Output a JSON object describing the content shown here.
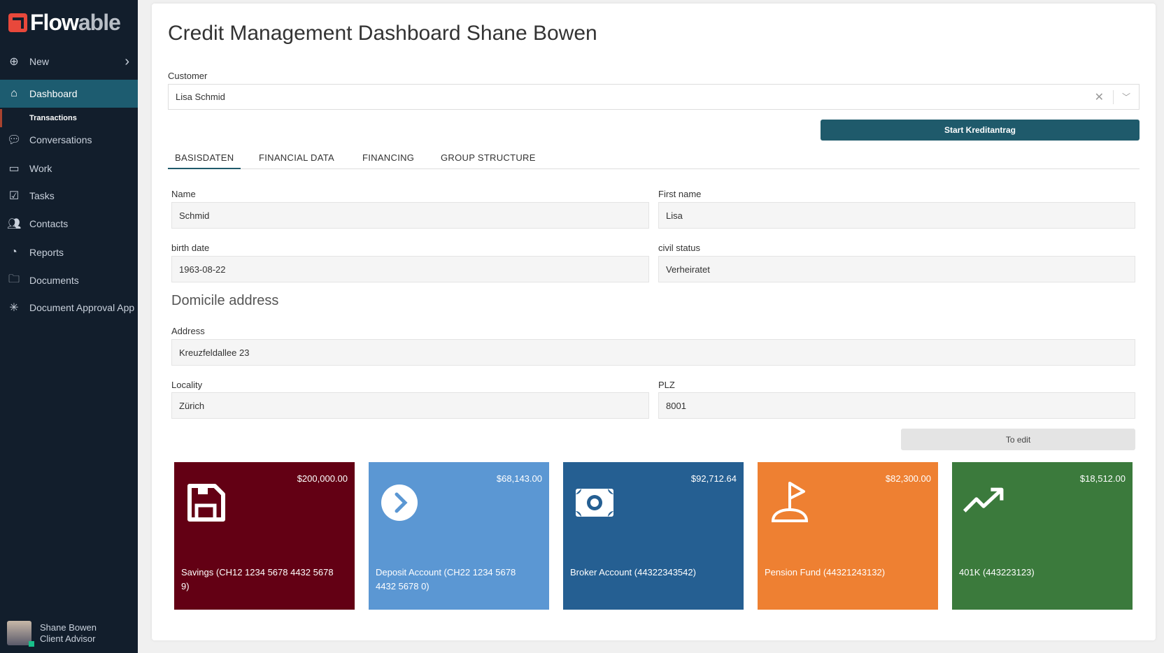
{
  "sidebar": {
    "logo": "Flowable",
    "items": [
      {
        "label": "New",
        "icon": "plus-circle-icon"
      },
      {
        "label": "Dashboard",
        "icon": "home-icon",
        "active": true
      },
      {
        "label": "Conversations",
        "icon": "chat-icon"
      },
      {
        "label": "Work",
        "icon": "inbox-icon"
      },
      {
        "label": "Tasks",
        "icon": "clipboard-check-icon"
      },
      {
        "label": "Contacts",
        "icon": "users-icon"
      },
      {
        "label": "Reports",
        "icon": "pie-chart-icon"
      },
      {
        "label": "Documents",
        "icon": "folder-icon"
      },
      {
        "label": "Document Approval App",
        "icon": "asterisk-icon"
      }
    ],
    "sub_item": "Transactions",
    "user": {
      "name": "Shane Bowen",
      "role": "Client Advisor",
      "status_color": "#18c08a"
    }
  },
  "main": {
    "title": "Credit Management Dashboard Shane Bowen",
    "customer_label": "Customer",
    "customer_value": "Lisa Schmid",
    "start_button": "Start Kreditantrag",
    "tabs": [
      "BASISDATEN",
      "FINANCIAL DATA",
      "FINANCING",
      "GROUP STRUCTURE"
    ],
    "fields": {
      "name": {
        "label": "Name",
        "value": "Schmid"
      },
      "first_name": {
        "label": "First name",
        "value": "Lisa"
      },
      "birth_date": {
        "label": "birth date",
        "value": "1963-08-22"
      },
      "civil_status": {
        "label": "civil status",
        "value": "Verheiratet"
      },
      "address": {
        "label": "Address",
        "value": "Kreuzfeldallee 23"
      },
      "locality": {
        "label": "Locality",
        "value": "Zürich"
      },
      "plz": {
        "label": "PLZ",
        "value": "8001"
      }
    },
    "domicile_heading": "Domicile address",
    "edit_button": "To edit",
    "accounts": [
      {
        "name": "Savings (CH12 1234 5678 4432 5678 9)",
        "amount": "$200,000.00",
        "color": "#630014",
        "icon": "floppy-disk-icon"
      },
      {
        "name": "Deposit Account (CH22 1234 5678 4432 5678 0)",
        "amount": "$68,143.00",
        "color": "#5b97d3",
        "icon": "chevron-right-circle-icon"
      },
      {
        "name": "Broker Account (44322343542)",
        "amount": "$92,712.64",
        "color": "#255f92",
        "icon": "money-bill-icon"
      },
      {
        "name": "Pension Fund (44321243132)",
        "amount": "$82,300.00",
        "color": "#ee8032",
        "icon": "golf-flag-icon"
      },
      {
        "name": "401K (443223123)",
        "amount": "$18,512.00",
        "color": "#3b7a3c",
        "icon": "trending-up-icon"
      }
    ]
  }
}
